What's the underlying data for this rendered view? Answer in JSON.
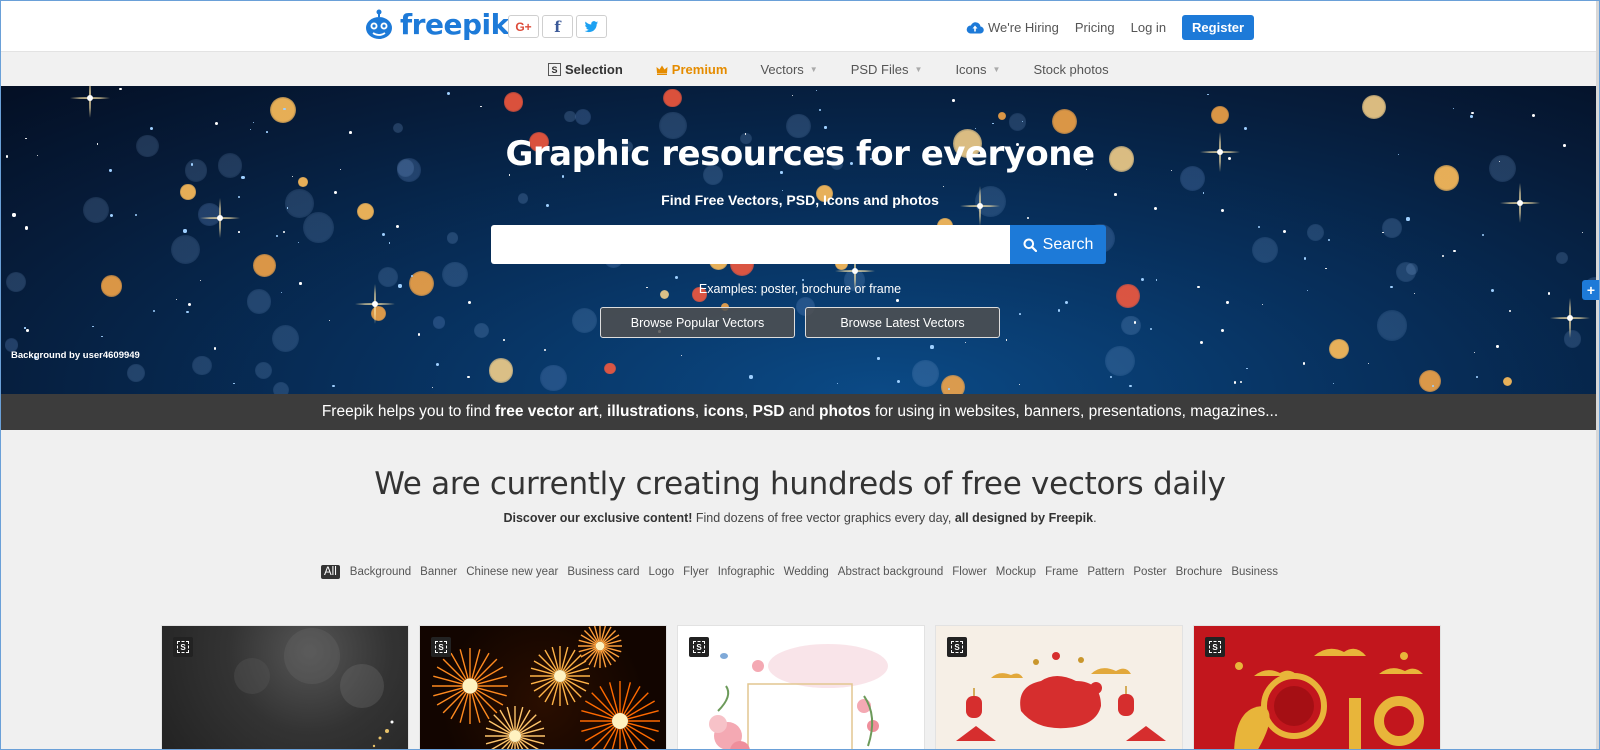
{
  "header": {
    "logo_text": "freepik",
    "social": {
      "google": "G+",
      "facebook": "f",
      "twitter": "t"
    },
    "hiring": "We're Hiring",
    "pricing": "Pricing",
    "login": "Log in",
    "register": "Register"
  },
  "nav": {
    "selection": "Selection",
    "selection_badge": "S",
    "premium": "Premium",
    "vectors": "Vectors",
    "psd_files": "PSD Files",
    "icons": "Icons",
    "stock_photos": "Stock photos"
  },
  "hero": {
    "title": "Graphic resources for everyone",
    "subtitle": "Find Free Vectors, PSD, Icons and photos",
    "search_placeholder": "",
    "search_button": "Search",
    "examples": "Examples: poster, brochure or frame",
    "browse_popular": "Browse Popular Vectors",
    "browse_latest": "Browse Latest Vectors",
    "credit": "Background by user4609949"
  },
  "tagline": {
    "p1": "Freepik helps you to find ",
    "b1": "free vector art",
    "s1": ", ",
    "b2": "illustrations",
    "s2": ", ",
    "b3": "icons",
    "s3": ", ",
    "b4": "PSD",
    "s4": " and ",
    "b5": "photos",
    "p2": " for using in websites, banners, presentations, magazines..."
  },
  "main": {
    "title": "We are currently creating hundreds of free vectors daily",
    "sub_b1": "Discover our exclusive content!",
    "sub_p1": " Find dozens of free vector graphics every day, ",
    "sub_b2": "all designed by Freepik",
    "sub_p2": "."
  },
  "tags": [
    "All",
    "Background",
    "Banner",
    "Chinese new year",
    "Business card",
    "Logo",
    "Flyer",
    "Infographic",
    "Wedding",
    "Abstract background",
    "Flower",
    "Mockup",
    "Frame",
    "Pattern",
    "Poster",
    "Brochure",
    "Business"
  ],
  "card_badge": "S",
  "colors": {
    "brand_blue": "#1d7ad8",
    "premium_orange": "#e58c00",
    "tagline_bg": "#3c3c3c",
    "nav_bg": "#f1f1f1"
  }
}
